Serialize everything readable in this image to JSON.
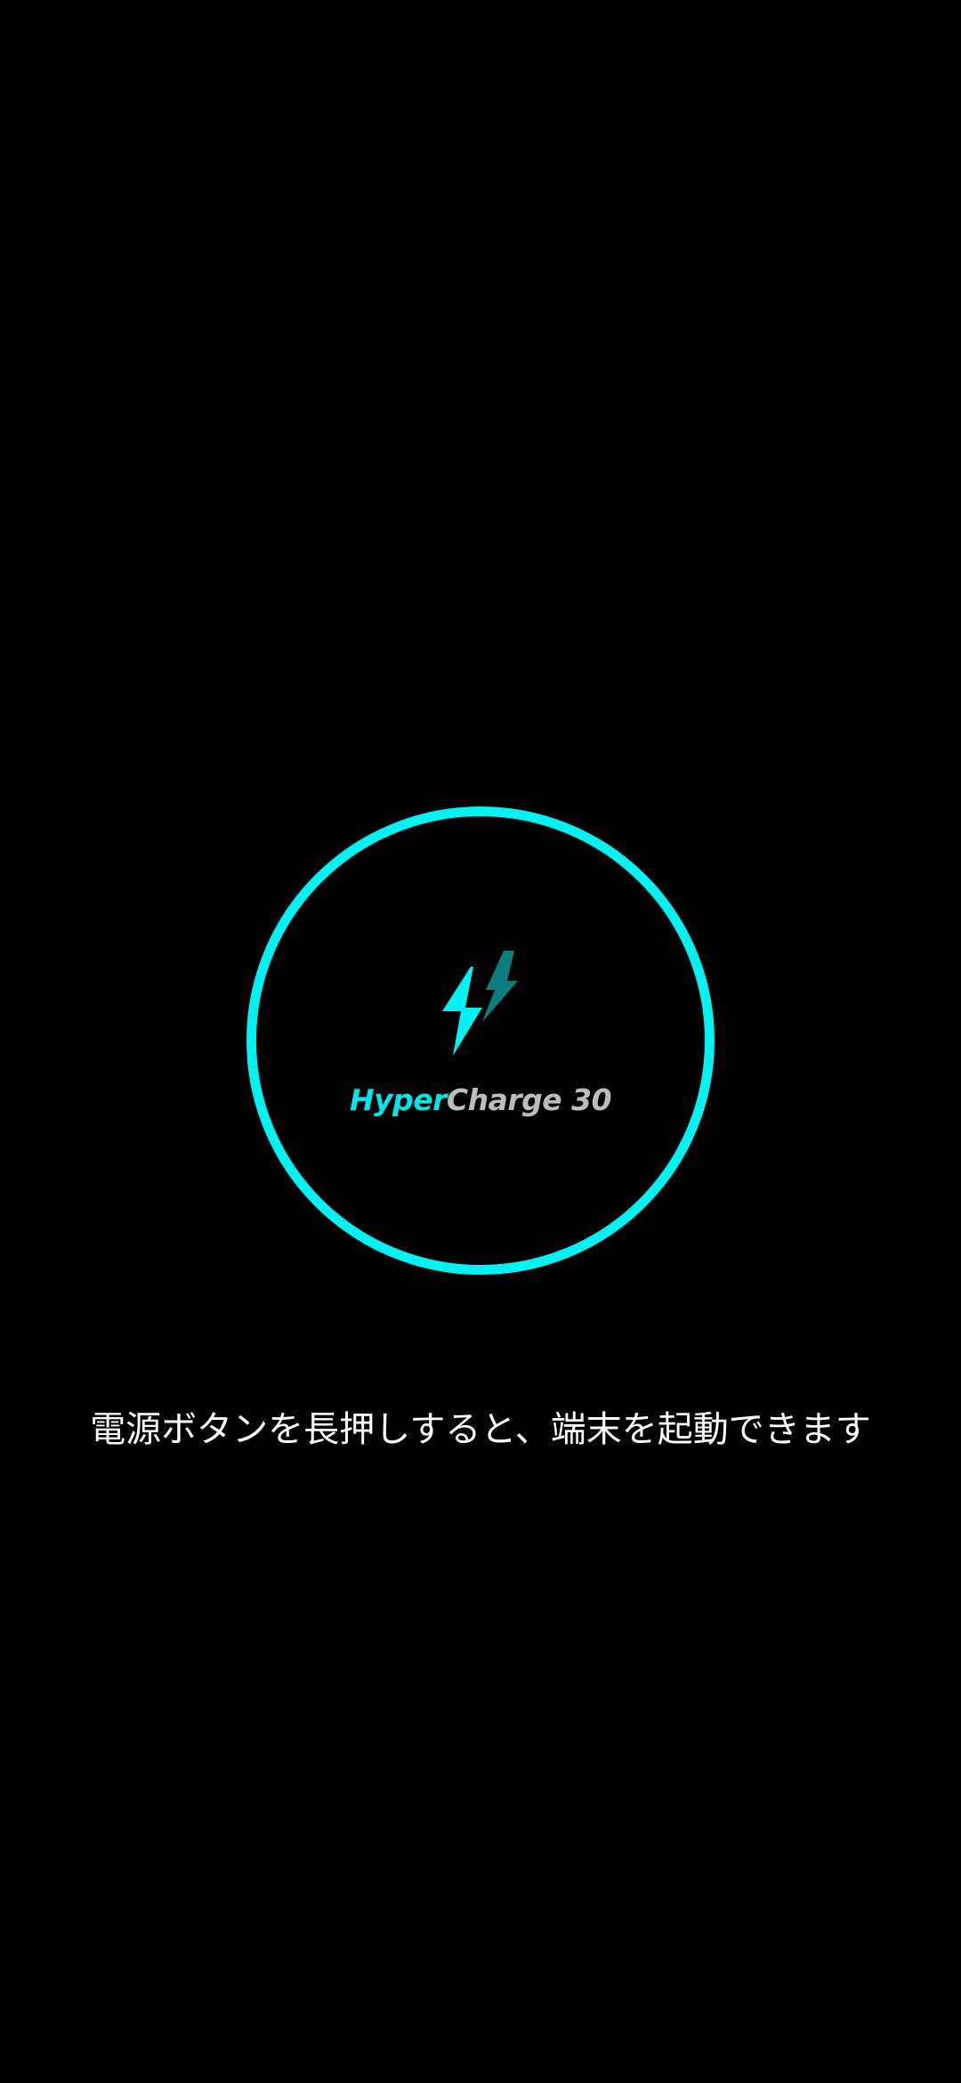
{
  "colors": {
    "background": "#000000",
    "accent": "#00f2f2",
    "accent_dim": "#0a7d7e",
    "brand_secondary": "#bdbdbd",
    "hint_text": "#ffffff"
  },
  "charging": {
    "icon": "double-lightning-bolt-icon",
    "brand_primary": "Hyper",
    "brand_secondary": "Charge 30"
  },
  "hint": {
    "text": "電源ボタンを長押しすると、端末を起動できます"
  }
}
